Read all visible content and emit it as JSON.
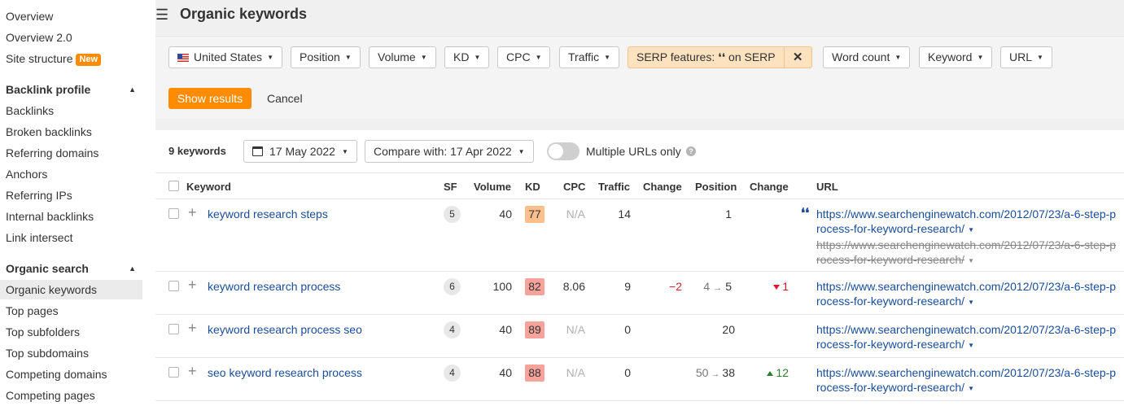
{
  "sidebar": {
    "top_items": [
      "Overview",
      "Overview 2.0",
      "Site structure"
    ],
    "new_badge": "New",
    "backlink_profile": {
      "title": "Backlink profile",
      "items": [
        "Backlinks",
        "Broken backlinks",
        "Referring domains",
        "Anchors",
        "Referring IPs",
        "Internal backlinks",
        "Link intersect"
      ]
    },
    "organic_search": {
      "title": "Organic search",
      "items": [
        "Organic keywords",
        "Top pages",
        "Top subfolders",
        "Top subdomains",
        "Competing domains",
        "Competing pages"
      ],
      "active": "Organic keywords"
    }
  },
  "header": {
    "title": "Organic keywords"
  },
  "filters": {
    "country": "United States",
    "position": "Position",
    "volume": "Volume",
    "kd": "KD",
    "cpc": "CPC",
    "traffic": "Traffic",
    "serp": "SERP features: ❛❛ on SERP",
    "word_count": "Word count",
    "keyword": "Keyword",
    "url": "URL",
    "show_results": "Show results",
    "cancel": "Cancel"
  },
  "results": {
    "count": "9 keywords",
    "date": "17 May 2022",
    "compare": "Compare with: 17 Apr 2022",
    "multiple_urls": "Multiple URLs only",
    "columns": [
      "Keyword",
      "SF",
      "Volume",
      "KD",
      "CPC",
      "Traffic",
      "Change",
      "Position",
      "Change",
      "URL"
    ],
    "rows": [
      {
        "keyword": "keyword research steps",
        "sf": "5",
        "volume": "40",
        "kd": "77",
        "kd_color": "#fdc08c",
        "cpc": "N/A",
        "traffic": "14",
        "change": "",
        "position": "1",
        "pos_change": "",
        "url": "https://www.searchenginewatch.com/2012/07/23/a-6-step-process-for-keyword-research/",
        "url_old": "https://www.searchenginewatch.com/2012/07/23/a-6-step-process-for-keyword-research/"
      },
      {
        "keyword": "keyword research process",
        "sf": "6",
        "volume": "100",
        "kd": "82",
        "kd_color": "#f7a39c",
        "cpc": "8.06",
        "traffic": "9",
        "change": "−2",
        "position_from": "4",
        "position_to": "5",
        "pos_change": "1",
        "url": "https://www.searchenginewatch.com/2012/07/23/a-6-step-process-for-keyword-research/"
      },
      {
        "keyword": "keyword research process seo",
        "sf": "4",
        "volume": "40",
        "kd": "89",
        "kd_color": "#f7a39c",
        "cpc": "N/A",
        "traffic": "0",
        "change": "",
        "position": "20",
        "pos_change": "",
        "url": "https://www.searchenginewatch.com/2012/07/23/a-6-step-process-for-keyword-research/"
      },
      {
        "keyword": "seo keyword research process",
        "sf": "4",
        "volume": "40",
        "kd": "88",
        "kd_color": "#f7a39c",
        "cpc": "N/A",
        "traffic": "0",
        "change": "",
        "position_from": "50",
        "position_to": "38",
        "pos_change": "12",
        "url": "https://www.searchenginewatch.com/2012/07/23/a-6-step-process-for-keyword-research/"
      }
    ]
  },
  "colors": {
    "accent": "#ff8c00",
    "link": "#1a4d99",
    "negative": "#d9192c",
    "positive": "#2e7d32"
  }
}
